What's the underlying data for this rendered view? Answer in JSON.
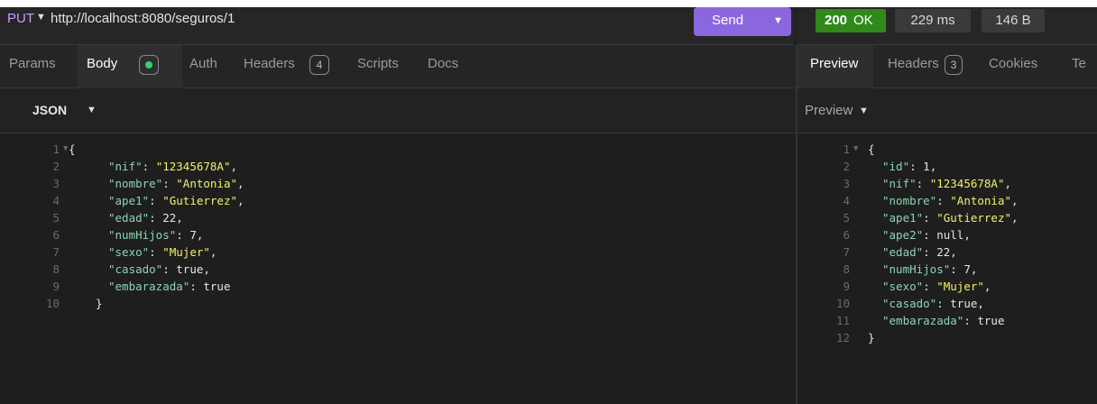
{
  "request": {
    "method": "PUT",
    "url": "http://localhost:8080/seguros/1",
    "send_label": "Send"
  },
  "response_meta": {
    "status_code": "200",
    "status_text": "OK",
    "time": "229 ms",
    "size": "146 B"
  },
  "request_tabs": {
    "params": "Params",
    "body": "Body",
    "auth": "Auth",
    "headers": "Headers",
    "headers_count": "4",
    "scripts": "Scripts",
    "docs": "Docs"
  },
  "response_tabs": {
    "preview": "Preview",
    "headers": "Headers",
    "headers_count": "3",
    "cookies": "Cookies",
    "truncated": "Te"
  },
  "request_body_mode": "JSON",
  "response_view_mode": "Preview",
  "colors": {
    "accent": "#8b67df",
    "status_ok": "#2f8a1b",
    "json_key": "#8fd4b0",
    "json_string": "#f2f26a"
  },
  "request_body_lines": [
    {
      "num": "1",
      "text": "{"
    },
    {
      "num": "2",
      "key": "\"nif\"",
      "value": "\"12345678A\"",
      "vtype": "s",
      "comma": ","
    },
    {
      "num": "3",
      "key": "\"nombre\"",
      "value": "\"Antonia\"",
      "vtype": "s",
      "comma": ","
    },
    {
      "num": "4",
      "key": "\"ape1\"",
      "value": "\"Gutierrez\"",
      "vtype": "s",
      "comma": ","
    },
    {
      "num": "5",
      "key": "\"edad\"",
      "value": "22",
      "vtype": "p",
      "comma": ","
    },
    {
      "num": "6",
      "key": "\"numHijos\"",
      "value": "7",
      "vtype": "p",
      "comma": ","
    },
    {
      "num": "7",
      "key": "\"sexo\"",
      "value": "\"Mujer\"",
      "vtype": "s",
      "comma": ","
    },
    {
      "num": "8",
      "key": "\"casado\"",
      "value": "true",
      "vtype": "p",
      "comma": ","
    },
    {
      "num": "9",
      "key": "\"embarazada\"",
      "value": "true",
      "vtype": "p",
      "comma": ""
    },
    {
      "num": "10",
      "text": "}"
    }
  ],
  "response_body_lines": [
    {
      "num": "1",
      "text": "{"
    },
    {
      "num": "2",
      "key": "\"id\"",
      "value": "1",
      "vtype": "p",
      "comma": ","
    },
    {
      "num": "3",
      "key": "\"nif\"",
      "value": "\"12345678A\"",
      "vtype": "s",
      "comma": ","
    },
    {
      "num": "4",
      "key": "\"nombre\"",
      "value": "\"Antonia\"",
      "vtype": "s",
      "comma": ","
    },
    {
      "num": "5",
      "key": "\"ape1\"",
      "value": "\"Gutierrez\"",
      "vtype": "s",
      "comma": ","
    },
    {
      "num": "6",
      "key": "\"ape2\"",
      "value": "null",
      "vtype": "p",
      "comma": ","
    },
    {
      "num": "7",
      "key": "\"edad\"",
      "value": "22",
      "vtype": "p",
      "comma": ","
    },
    {
      "num": "8",
      "key": "\"numHijos\"",
      "value": "7",
      "vtype": "p",
      "comma": ","
    },
    {
      "num": "9",
      "key": "\"sexo\"",
      "value": "\"Mujer\"",
      "vtype": "s",
      "comma": ","
    },
    {
      "num": "10",
      "key": "\"casado\"",
      "value": "true",
      "vtype": "p",
      "comma": ","
    },
    {
      "num": "11",
      "key": "\"embarazada\"",
      "value": "true",
      "vtype": "p",
      "comma": ""
    },
    {
      "num": "12",
      "text": "}"
    }
  ]
}
